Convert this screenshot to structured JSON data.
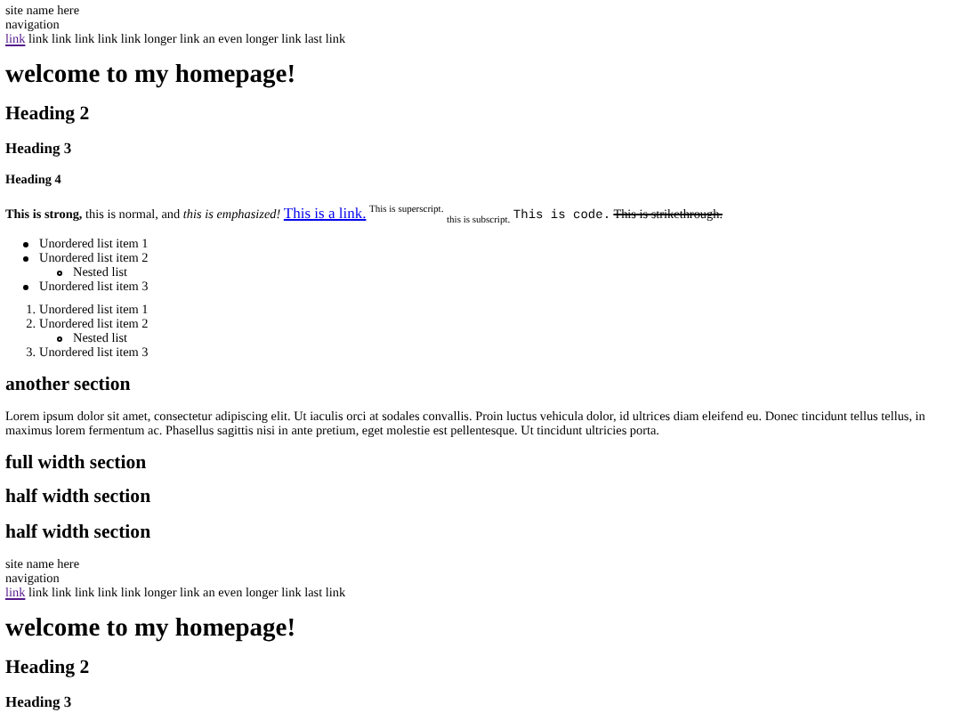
{
  "blocks": [
    {
      "kind": "site_name",
      "text": "site name here"
    },
    {
      "kind": "nav_label",
      "text": "navigation"
    },
    {
      "kind": "nav",
      "items": [
        {
          "kind": "link",
          "text": "link"
        },
        {
          "kind": "text",
          "text": "link link link link link longer link an even longer link last link"
        }
      ]
    },
    {
      "kind": "h1",
      "text": "welcome to my homepage!"
    },
    {
      "kind": "h2",
      "text": "Heading 2"
    },
    {
      "kind": "h3",
      "text": "Heading 3"
    },
    {
      "kind": "h4",
      "text": "Heading 4"
    },
    {
      "kind": "inline",
      "runs": [
        {
          "kind": "strong",
          "text": "This is strong,"
        },
        {
          "kind": "normal",
          "text": "this is normal, and"
        },
        {
          "kind": "em",
          "text": "this is emphasized!"
        },
        {
          "kind": "link",
          "text": "This is a link."
        },
        {
          "kind": "sup",
          "text": "This is superscript."
        },
        {
          "kind": "sub",
          "text": "this is subscript."
        },
        {
          "kind": "code",
          "text": "This is code."
        },
        {
          "kind": "strike",
          "text": "This is strikethrough."
        }
      ]
    },
    {
      "kind": "ul",
      "items": [
        {
          "text": "Unordered list item 1"
        },
        {
          "text": "Unordered list item 2",
          "children": [
            {
              "text": "Nested list"
            }
          ]
        },
        {
          "text": "Unordered list item 3"
        }
      ]
    },
    {
      "kind": "ol",
      "items": [
        {
          "number": "1.",
          "text": "Unordered list item 1"
        },
        {
          "number": "2.",
          "text": "Unordered list item 2",
          "children": [
            {
              "text": "Nested list"
            }
          ]
        },
        {
          "number": "3.",
          "text": "Unordered list item 3"
        }
      ]
    },
    {
      "kind": "h2",
      "text": "another section"
    },
    {
      "kind": "p",
      "text": "Lorem ipsum dolor sit amet, consectetur adipiscing elit. Ut iaculis orci at sodales convallis. Proin luctus vehicula dolor, id ultrices diam eleifend eu. Donec tincidunt tellus tellus, in maximus lorem fermentum ac. Phasellus sagittis nisi in ante pretium, eget molestie est pellentesque. Ut tincidunt ultricies porta."
    },
    {
      "kind": "h2",
      "text": "full width section"
    },
    {
      "kind": "h2",
      "text": "half width section"
    },
    {
      "kind": "h2",
      "text": "half width section"
    },
    {
      "kind": "site_name",
      "text": "site name here"
    },
    {
      "kind": "nav_label",
      "text": "navigation"
    },
    {
      "kind": "nav",
      "items": [
        {
          "kind": "link",
          "text": "link"
        },
        {
          "kind": "text",
          "text": "link link link link link longer link an even longer link last link"
        }
      ]
    },
    {
      "kind": "h1",
      "text": "welcome to my homepage!"
    },
    {
      "kind": "h2",
      "text": "Heading 2"
    },
    {
      "kind": "h3",
      "text": "Heading 3"
    }
  ]
}
